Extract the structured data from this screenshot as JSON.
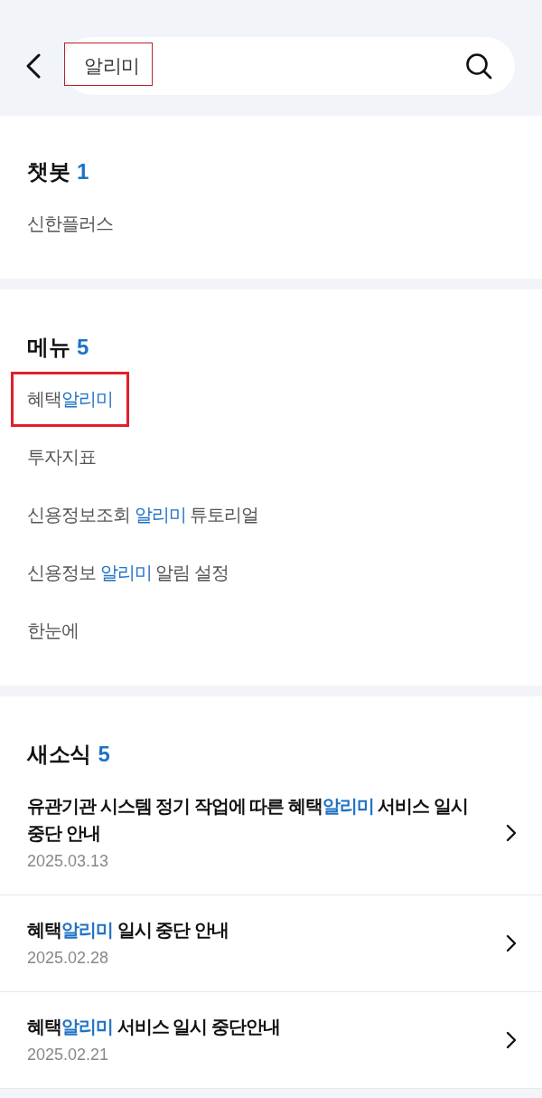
{
  "search": {
    "value": "알리미",
    "outlined": true
  },
  "sections": [
    {
      "kind": "list",
      "title": "챗봇",
      "count": "1",
      "items": [
        {
          "outlined": false,
          "parts": [
            {
              "text": "신한플러스",
              "match": false
            }
          ]
        }
      ]
    },
    {
      "kind": "list",
      "title": "메뉴",
      "count": "5",
      "items": [
        {
          "outlined": true,
          "parts": [
            {
              "text": "혜택",
              "match": false
            },
            {
              "text": "알리미",
              "match": true
            }
          ]
        },
        {
          "outlined": false,
          "parts": [
            {
              "text": "투자지표",
              "match": false
            }
          ]
        },
        {
          "outlined": false,
          "parts": [
            {
              "text": "신용정보조회 ",
              "match": false
            },
            {
              "text": "알리미",
              "match": true
            },
            {
              "text": " 튜토리얼",
              "match": false
            }
          ]
        },
        {
          "outlined": false,
          "parts": [
            {
              "text": "신용정보 ",
              "match": false
            },
            {
              "text": "알리미",
              "match": true
            },
            {
              "text": " 알림 설정",
              "match": false
            }
          ]
        },
        {
          "outlined": false,
          "parts": [
            {
              "text": "한눈에",
              "match": false
            }
          ]
        }
      ]
    },
    {
      "kind": "news",
      "title": "새소식",
      "count": "5",
      "items": [
        {
          "parts": [
            {
              "text": "유관기관 시스템 정기 작업에 따른 혜택",
              "match": false
            },
            {
              "text": "알리미",
              "match": true
            },
            {
              "text": " 서비스 일시 중단 안내",
              "match": false
            }
          ],
          "date": "2025.03.13"
        },
        {
          "parts": [
            {
              "text": "혜택",
              "match": false
            },
            {
              "text": "알리미",
              "match": true
            },
            {
              "text": " 일시 중단 안내",
              "match": false
            }
          ],
          "date": "2025.02.28"
        },
        {
          "parts": [
            {
              "text": "혜택",
              "match": false
            },
            {
              "text": "알리미",
              "match": true
            },
            {
              "text": " 서비스 일시 중단안내",
              "match": false
            }
          ],
          "date": "2025.02.21"
        }
      ]
    }
  ]
}
